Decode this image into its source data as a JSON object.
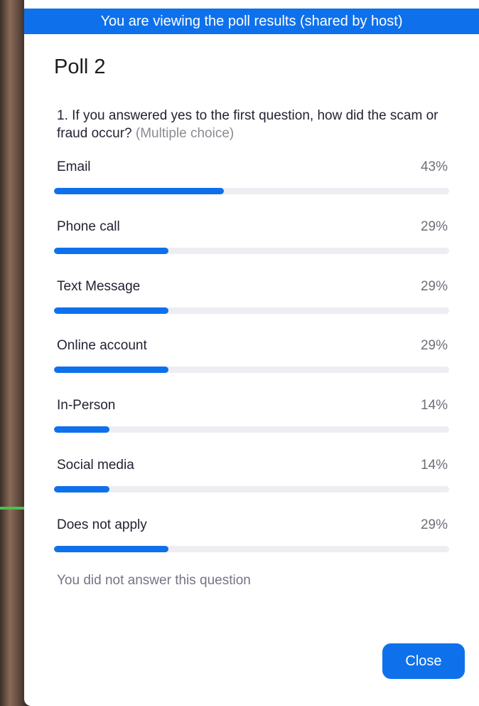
{
  "banner": {
    "text": "You are viewing the poll results (shared by host)"
  },
  "poll": {
    "title": "Poll 2",
    "question": {
      "text": "1. If you answered yes to the first question, how did the scam or fraud occur?",
      "type": "(Multiple choice)"
    },
    "options": [
      {
        "label": "Email",
        "percent_label": "43%",
        "percent": 43
      },
      {
        "label": "Phone call",
        "percent_label": "29%",
        "percent": 29
      },
      {
        "label": "Text Message",
        "percent_label": "29%",
        "percent": 29
      },
      {
        "label": "Online account",
        "percent_label": "29%",
        "percent": 29
      },
      {
        "label": "In-Person",
        "percent_label": "14%",
        "percent": 14
      },
      {
        "label": "Social media",
        "percent_label": "14%",
        "percent": 14
      },
      {
        "label": "Does not apply",
        "percent_label": "29%",
        "percent": 29
      }
    ],
    "status": "You did not answer this question"
  },
  "actions": {
    "close_label": "Close"
  },
  "colors": {
    "accent": "#0e71eb",
    "track": "#eeeef2"
  }
}
